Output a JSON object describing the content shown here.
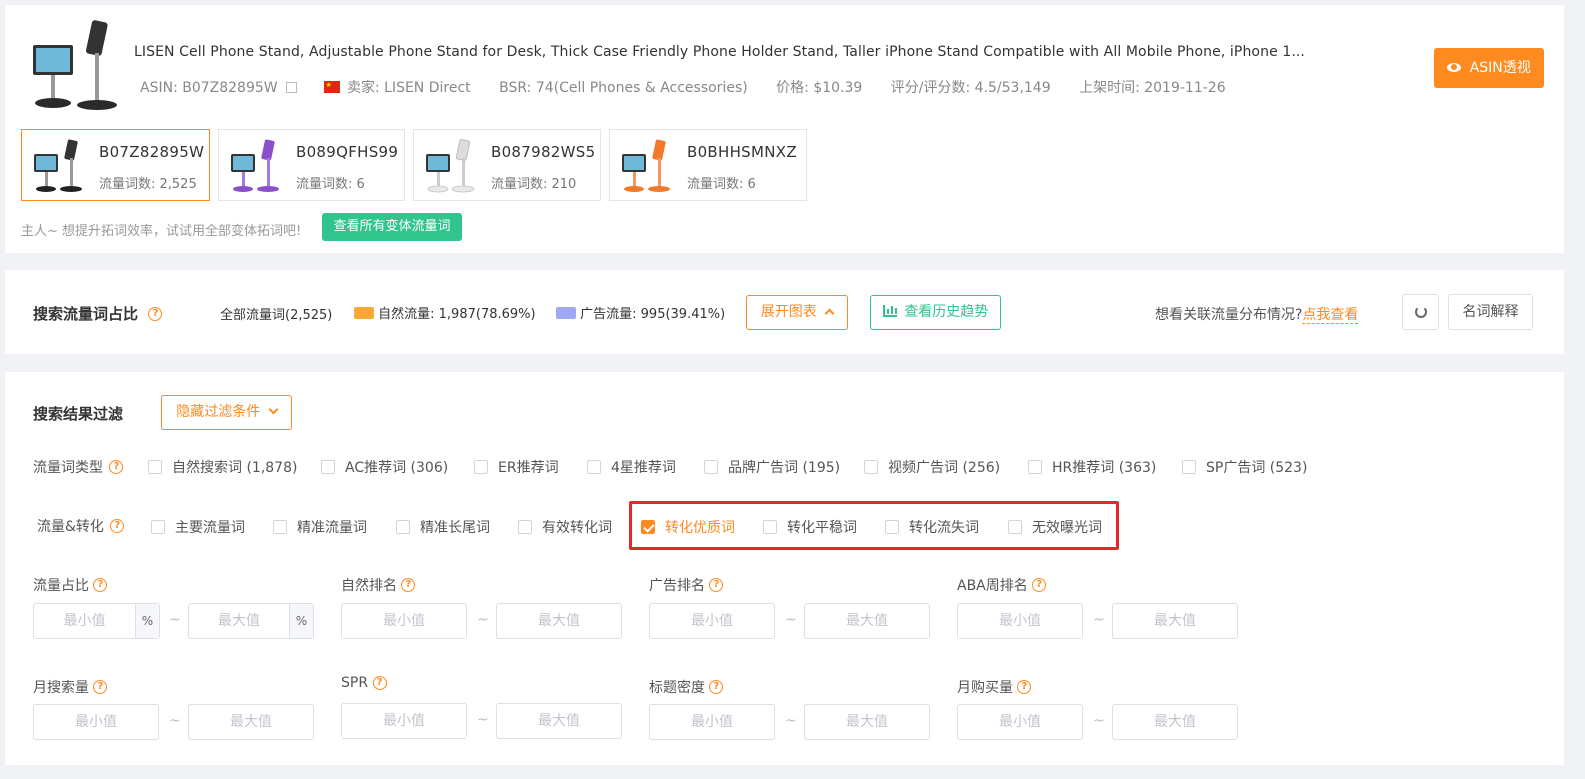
{
  "product": {
    "title": "LISEN Cell Phone Stand, Adjustable Phone Stand for Desk, Thick Case Friendly Phone Holder Stand, Taller iPhone Stand Compatible with All Mobile Phone, iPhone 1...",
    "asin": "ASIN: B07Z82895W",
    "seller": "卖家: LISEN Direct",
    "bsr": "BSR: 74(Cell Phones & Accessories)",
    "price": "价格: $10.39",
    "rating": "评分/评分数: 4.5/53,149",
    "listed": "上架时间: 2019-11-26",
    "asin_view_button": "ASIN透视"
  },
  "variants": [
    {
      "asin": "B07Z82895W",
      "count": "流量词数: 2,525",
      "color": "#222222"
    },
    {
      "asin": "B089QFHS99",
      "count": "流量词数: 6",
      "color": "#8b4fc9"
    },
    {
      "asin": "B087982WS5",
      "count": "流量词数: 210",
      "color": "#e8e8e8"
    },
    {
      "asin": "B0BHHSMNXZ",
      "count": "流量词数: 6",
      "color": "#f07a2a"
    }
  ],
  "tip": {
    "text": "主人~ 想提升拓词效率，试试用全部变体拓词吧!",
    "button": "查看所有变体流量词"
  },
  "ratio": {
    "title": "搜索流量词占比",
    "all": "全部流量词(2,525)",
    "natural": "自然流量: 1,987(78.69%)",
    "ads": "广告流量: 995(39.41%)",
    "expand_button": "展开图表",
    "history_button": "查看历史趋势",
    "related_text": "想看关联流量分布情况?",
    "related_link": "点我查看",
    "glossary_button": "名词解释",
    "natural_color": "#f8a833",
    "ads_color": "#9fa8f4"
  },
  "filter": {
    "title": "搜索结果过滤",
    "hide_button": "隐藏过滤条件",
    "type_label": "流量词类型",
    "type_options": [
      "自然搜索词 (1,878)",
      "AC推荐词 (306)",
      "ER推荐词",
      "4星推荐词",
      "品牌广告词 (195)",
      "视频广告词 (256)",
      "HR推荐词 (363)",
      "SP广告词 (523)"
    ],
    "conv_label": "流量&转化",
    "conv_options": [
      "主要流量词",
      "精准流量词",
      "精准长尾词",
      "有效转化词",
      "转化优质词",
      "转化平稳词",
      "转化流失词",
      "无效曝光词"
    ],
    "fields": [
      "流量占比",
      "自然排名",
      "广告排名",
      "ABA周排名",
      "月搜索量",
      "SPR",
      "标题密度",
      "月购买量"
    ],
    "min_placeholder": "最小值",
    "max_placeholder": "最大值",
    "percent": "%",
    "tilde": "~"
  }
}
